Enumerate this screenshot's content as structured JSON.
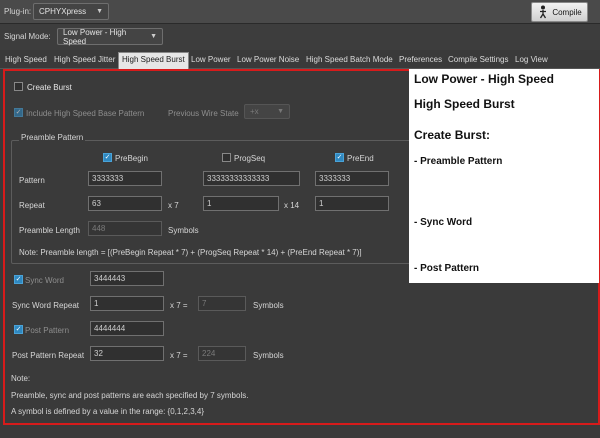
{
  "topbar": {
    "plugin_label": "Plug-in:",
    "plugin_value": "CPHYXpress",
    "compile_label": "Compile"
  },
  "signal": {
    "label": "Signal Mode:",
    "value": "Low Power - High Speed"
  },
  "tabs": [
    {
      "label": "High Speed"
    },
    {
      "label": "High Speed Jitter"
    },
    {
      "label": "High Speed Burst"
    },
    {
      "label": "Low Power"
    },
    {
      "label": "Low Power Noise"
    },
    {
      "label": "High Speed Batch Mode"
    },
    {
      "label": "Preferences"
    },
    {
      "label": "Compile Settings"
    },
    {
      "label": "Log View"
    }
  ],
  "active_tab_index": 2,
  "form": {
    "create_burst": "Create Burst",
    "include_hs_base": "Include High Speed Base Pattern",
    "previous_wire_state_label": "Previous Wire State",
    "previous_wire_state_value": "+x",
    "preamble_group": "Preamble Pattern",
    "prebegin": "PreBegin",
    "progseq": "ProgSeq",
    "preend": "PreEnd",
    "pattern_label": "Pattern",
    "prebegin_pattern": "3333333",
    "progseq_pattern": "33333333333333",
    "preend_pattern": "3333333",
    "repeat_label": "Repeat",
    "prebegin_repeat": "63",
    "x7_a": "x 7",
    "progseq_repeat": "1",
    "x14": "x 14",
    "preend_repeat": "1",
    "preamble_length_label": "Preamble Length",
    "preamble_length_value": "448",
    "symbols_a": "Symbols",
    "preamble_note": "Note: Preamble length = [(PreBegin Repeat * 7) + (ProgSeq Repeat * 14) + (PreEnd Repeat * 7)]",
    "sync_word_label": "Sync Word",
    "sync_word_value": "3444443",
    "sync_word_repeat_label": "Sync Word Repeat",
    "sync_word_repeat_value": "1",
    "x7_eq_a": "x 7 =",
    "sync_total": "7",
    "symbols_b": "Symbols",
    "post_pattern_label": "Post Pattern",
    "post_pattern_value": "4444444",
    "post_pattern_repeat_label": "Post Pattern Repeat",
    "post_pattern_repeat_value": "32",
    "x7_eq_b": "x 7 =",
    "post_total": "224",
    "symbols_c": "Symbols",
    "note_title": "Note:",
    "note_line1": "Preamble, sync and post patterns are each specified by 7 symbols.",
    "note_line2": "A symbol is defined by a value in the range: {0,1,2,3,4}"
  },
  "overlay": {
    "line1": "Low Power - High Speed",
    "line2": "High Speed Burst",
    "line3": "Create Burst:",
    "line4": "- Preamble Pattern",
    "line5": "- Sync Word",
    "line6": "- Post Pattern"
  },
  "colors": {
    "highlight_border": "#d71b1b",
    "checkbox_accent": "#2f88c0"
  }
}
